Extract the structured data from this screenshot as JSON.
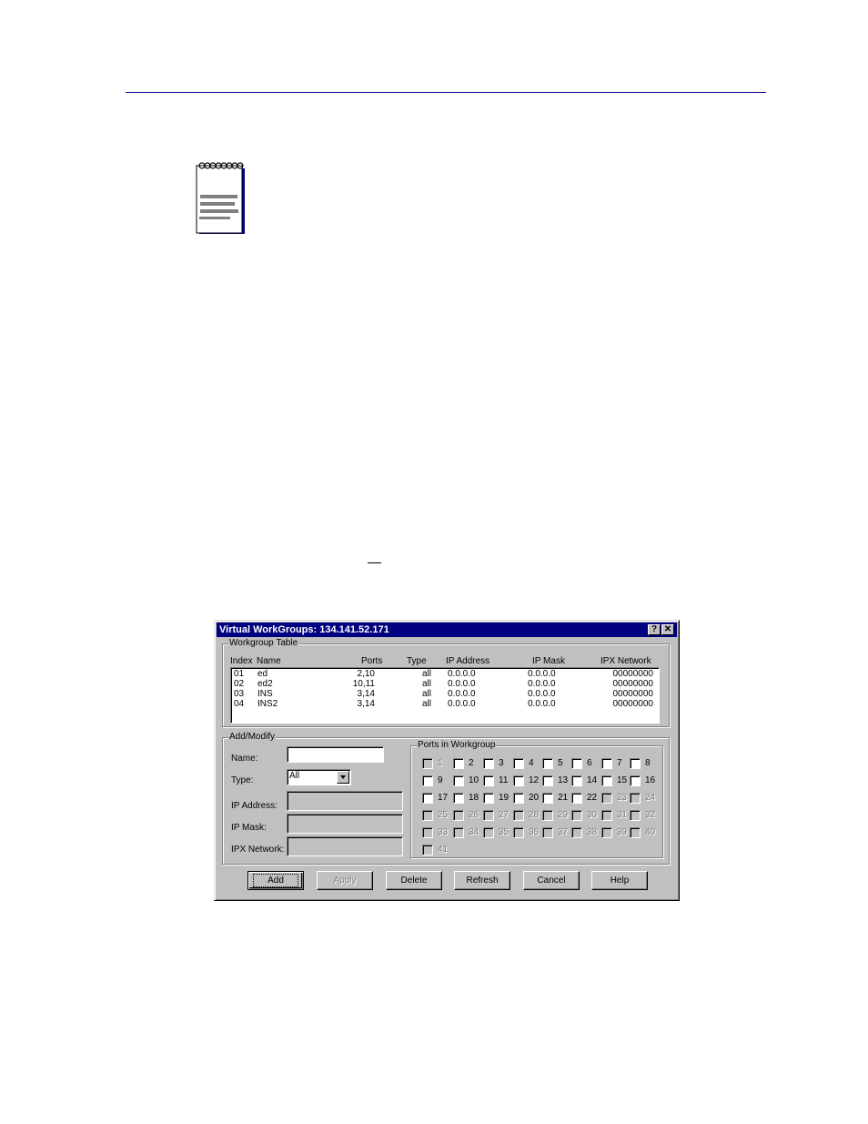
{
  "page": {
    "header_rule_color": "#00008b",
    "note_icon": "notepad-icon"
  },
  "dialog": {
    "title": "Virtual WorkGroups: 134.141.52.171",
    "title_buttons": {
      "help": "?",
      "close": "✕"
    },
    "workgroup_table": {
      "group_label": "Workgroup Table",
      "columns": [
        "Index",
        "Name",
        "Ports",
        "Type",
        "IP Address",
        "IP Mask",
        "IPX Network"
      ],
      "rows": [
        {
          "index": "01",
          "name": "ed",
          "ports": "2,10",
          "type": "all",
          "ip_address": "0.0.0.0",
          "ip_mask": "0.0.0.0",
          "ipx_network": "00000000"
        },
        {
          "index": "02",
          "name": "ed2",
          "ports": "10,11",
          "type": "all",
          "ip_address": "0.0.0.0",
          "ip_mask": "0.0.0.0",
          "ipx_network": "00000000"
        },
        {
          "index": "03",
          "name": "INS",
          "ports": "3,14",
          "type": "all",
          "ip_address": "0.0.0.0",
          "ip_mask": "0.0.0.0",
          "ipx_network": "00000000"
        },
        {
          "index": "04",
          "name": "INS2",
          "ports": "3,14",
          "type": "all",
          "ip_address": "0.0.0.0",
          "ip_mask": "0.0.0.0",
          "ipx_network": "00000000"
        }
      ]
    },
    "add_modify": {
      "group_label": "Add/Modify",
      "name_label": "Name:",
      "name_value": "",
      "type_label": "Type:",
      "type_value": "All",
      "ip_address_label": "IP Address:",
      "ip_address_value": "",
      "ip_mask_label": "IP Mask:",
      "ip_mask_value": "",
      "ipx_network_label": "IPX Network:",
      "ipx_network_value": ""
    },
    "ports": {
      "group_label": "Ports in Workgroup",
      "items": [
        {
          "n": "1",
          "enabled": false,
          "checked": false
        },
        {
          "n": "2",
          "enabled": true,
          "checked": false
        },
        {
          "n": "3",
          "enabled": true,
          "checked": false
        },
        {
          "n": "4",
          "enabled": true,
          "checked": false
        },
        {
          "n": "5",
          "enabled": true,
          "checked": false
        },
        {
          "n": "6",
          "enabled": true,
          "checked": false
        },
        {
          "n": "7",
          "enabled": true,
          "checked": false
        },
        {
          "n": "8",
          "enabled": true,
          "checked": false
        },
        {
          "n": "9",
          "enabled": true,
          "checked": false
        },
        {
          "n": "10",
          "enabled": true,
          "checked": false
        },
        {
          "n": "11",
          "enabled": true,
          "checked": false
        },
        {
          "n": "12",
          "enabled": true,
          "checked": false
        },
        {
          "n": "13",
          "enabled": true,
          "checked": false
        },
        {
          "n": "14",
          "enabled": true,
          "checked": false
        },
        {
          "n": "15",
          "enabled": true,
          "checked": false
        },
        {
          "n": "16",
          "enabled": true,
          "checked": false
        },
        {
          "n": "17",
          "enabled": true,
          "checked": false
        },
        {
          "n": "18",
          "enabled": true,
          "checked": false
        },
        {
          "n": "19",
          "enabled": true,
          "checked": false
        },
        {
          "n": "20",
          "enabled": true,
          "checked": false
        },
        {
          "n": "21",
          "enabled": true,
          "checked": false
        },
        {
          "n": "22",
          "enabled": true,
          "checked": false
        },
        {
          "n": "23",
          "enabled": false,
          "checked": false
        },
        {
          "n": "24",
          "enabled": false,
          "checked": false
        },
        {
          "n": "25",
          "enabled": false,
          "checked": false
        },
        {
          "n": "26",
          "enabled": false,
          "checked": false
        },
        {
          "n": "27",
          "enabled": false,
          "checked": false
        },
        {
          "n": "28",
          "enabled": false,
          "checked": false
        },
        {
          "n": "29",
          "enabled": false,
          "checked": false
        },
        {
          "n": "30",
          "enabled": false,
          "checked": false
        },
        {
          "n": "31",
          "enabled": false,
          "checked": false
        },
        {
          "n": "32",
          "enabled": false,
          "checked": false
        },
        {
          "n": "33",
          "enabled": false,
          "checked": false
        },
        {
          "n": "34",
          "enabled": false,
          "checked": false
        },
        {
          "n": "35",
          "enabled": false,
          "checked": false
        },
        {
          "n": "36",
          "enabled": false,
          "checked": false
        },
        {
          "n": "37",
          "enabled": false,
          "checked": false
        },
        {
          "n": "38",
          "enabled": false,
          "checked": false
        },
        {
          "n": "39",
          "enabled": false,
          "checked": false
        },
        {
          "n": "40",
          "enabled": false,
          "checked": false
        },
        {
          "n": "41",
          "enabled": false,
          "checked": false
        }
      ]
    },
    "buttons": {
      "add": "Add",
      "apply": "Apply",
      "delete": "Delete",
      "refresh": "Refresh",
      "cancel": "Cancel",
      "help": "Help"
    }
  }
}
